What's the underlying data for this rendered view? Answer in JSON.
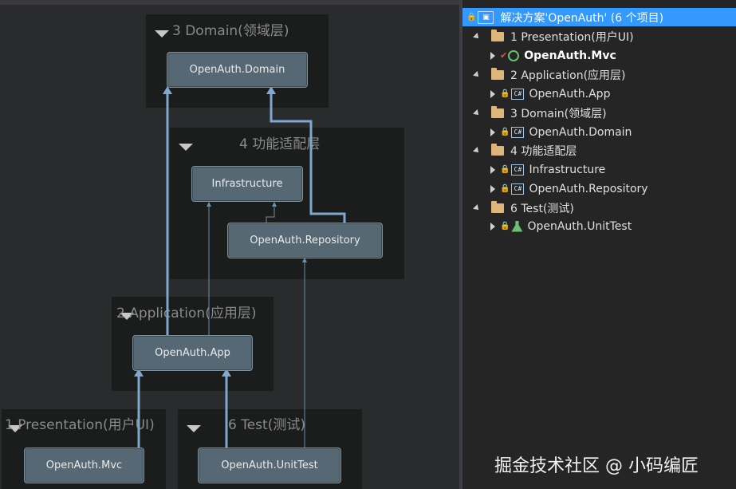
{
  "diagram": {
    "layers": {
      "domain": "3 Domain(领域层)",
      "adapter": "4 功能适配层",
      "application": "2 Application(应用层)",
      "presentation": "1 Presentation(用户UI)",
      "test": "6 Test(测试)"
    },
    "nodes": {
      "domain": "OpenAuth.Domain",
      "infrastructure": "Infrastructure",
      "repository": "OpenAuth.Repository",
      "app": "OpenAuth.App",
      "mvc": "OpenAuth.Mvc",
      "unittest": "OpenAuth.UnitTest"
    }
  },
  "explorer": {
    "solution": "解决方案'OpenAuth' (6 个项目)",
    "items": [
      {
        "label": "1 Presentation(用户UI)"
      },
      {
        "label": "OpenAuth.Mvc"
      },
      {
        "label": "2 Application(应用层)"
      },
      {
        "label": "OpenAuth.App"
      },
      {
        "label": "3 Domain(领域层)"
      },
      {
        "label": "OpenAuth.Domain"
      },
      {
        "label": "4 功能适配层"
      },
      {
        "label": "Infrastructure"
      },
      {
        "label": "OpenAuth.Repository"
      },
      {
        "label": "6 Test(测试)"
      },
      {
        "label": "OpenAuth.UnitTest"
      }
    ],
    "icons": {
      "cs": "C#"
    }
  },
  "watermark": "掘金技术社区 @ 小码编匠",
  "colors": {
    "selection": "#3399ff",
    "edge": "#7fa7cf",
    "node": "#566873"
  }
}
